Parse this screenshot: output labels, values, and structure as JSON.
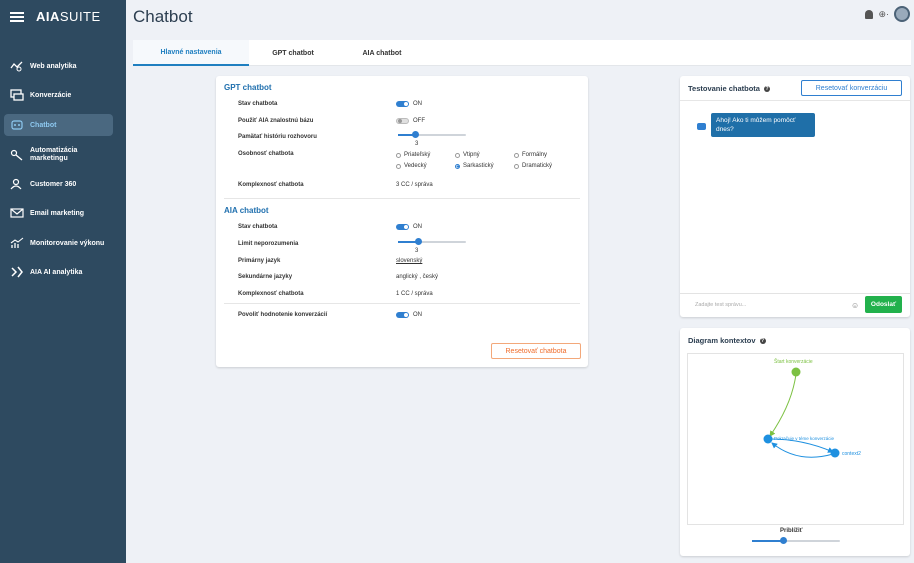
{
  "app": {
    "logo_bold": "AIA",
    "logo_light": "SUITE",
    "page_title": "Chatbot"
  },
  "sidebar": {
    "items": [
      {
        "label": "Web analytika",
        "icon": "web-analytics-icon"
      },
      {
        "label": "Konverzácie",
        "icon": "conversations-icon"
      },
      {
        "label": "Chatbot",
        "icon": "chatbot-icon",
        "active": true
      },
      {
        "label": "Automatizácia marketingu",
        "icon": "automation-icon"
      },
      {
        "label": "Customer 360",
        "icon": "customer-icon"
      },
      {
        "label": "Email marketing",
        "icon": "email-icon"
      },
      {
        "label": "Monitorovanie výkonu",
        "icon": "monitoring-icon"
      },
      {
        "label": "AIA AI analytika",
        "icon": "ai-analytics-icon"
      }
    ]
  },
  "header": {
    "lang": "⊕·"
  },
  "tabs": [
    {
      "label": "Hlavné nastavenia",
      "active": true
    },
    {
      "label": "GPT chatbot"
    },
    {
      "label": "AIA chatbot"
    }
  ],
  "gpt": {
    "title": "GPT chatbot",
    "status_label": "Stav chatbota",
    "status_value": "ON",
    "db_label": "Použiť AIA znalostnú bázu",
    "db_value": "OFF",
    "history_label": "Pamätať históriu rozhovoru",
    "history_value": "3",
    "history_fraction": 0.25,
    "personality_label": "Osobnosť chatbota",
    "personality_options": [
      "Priateľský",
      "Vtipný",
      "Formálny",
      "Vedecký",
      "Sarkastický",
      "Dramatický"
    ],
    "personality_selected": "Sarkastický",
    "complexity_label": "Komplexnosť chatbota",
    "complexity_value": "3 CC / správa"
  },
  "aia": {
    "title": "AIA chatbot",
    "status_label": "Stav chatbota",
    "status_value": "ON",
    "limit_label": "Limit neporozumenia",
    "limit_value": "3",
    "limit_fraction": 0.3,
    "primary_label": "Primárny jazyk",
    "primary_value": "slovenský",
    "secondary_label": "Sekundárne jazyky",
    "secondary_value": "anglický , český",
    "complexity_label": "Komplexnosť chatbota",
    "complexity_value": "1 CC / správa",
    "rating_label": "Povoliť hodnotenie konverzácií",
    "rating_value": "ON",
    "reset_button": "Resetovať chatbota"
  },
  "test": {
    "title": "Testovanie chatbota",
    "help": "?",
    "reset_button": "Resetovať konverzáciu",
    "bot_message": "Ahoj! Ako ti môžem pomôcť dnes?",
    "input_placeholder": "Zadajte test správu...",
    "send_button": "Odoslať"
  },
  "diagram": {
    "title": "Diagram kontextov",
    "help": "?",
    "nodes": [
      "Štart konverzácie",
      "Pokračuje v téme konverzácie",
      "context2"
    ],
    "zoom_label": "Priblížiť",
    "zoom_fraction": 0.35,
    "colors": {
      "start": "#7cc142",
      "node": "#1e90e0"
    }
  }
}
